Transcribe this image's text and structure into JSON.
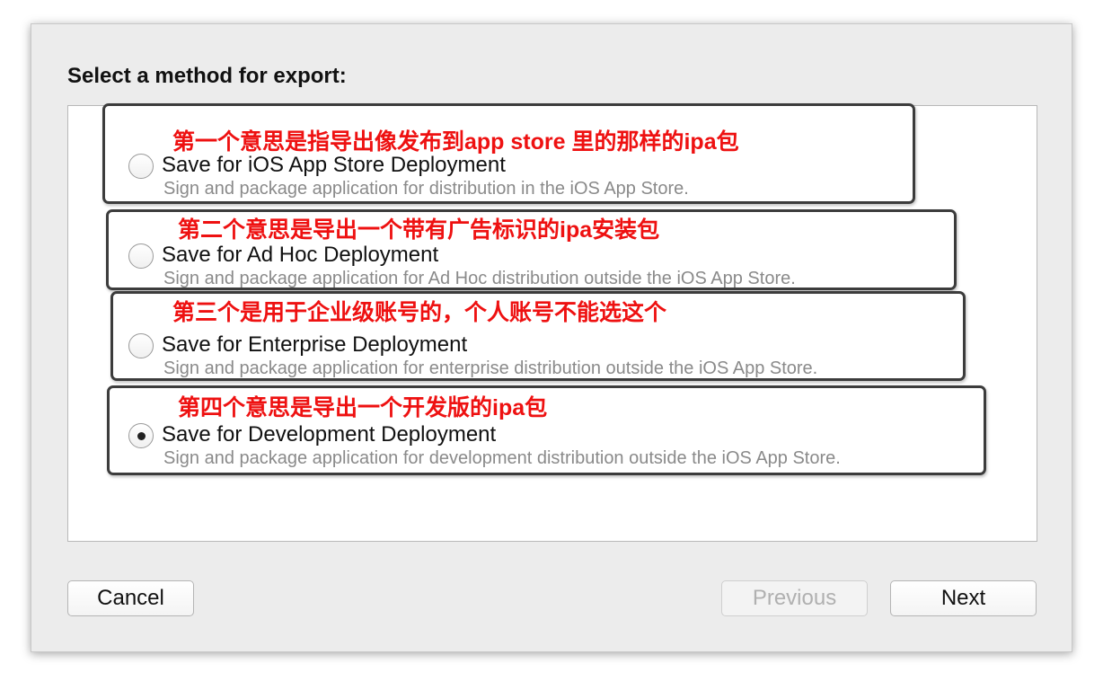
{
  "dialog": {
    "heading": "Select a method for export:"
  },
  "options": [
    {
      "title": "Save for iOS App Store Deployment",
      "description": "Sign and package application for distribution in the iOS App Store.",
      "selected": false,
      "annotation": "第一个意思是指导出像发布到app store 里的那样的ipa包"
    },
    {
      "title": "Save for Ad Hoc Deployment",
      "description": "Sign and package application for Ad Hoc distribution outside the iOS App Store.",
      "selected": false,
      "annotation": "第二个意思是导出一个带有广告标识的ipa安装包"
    },
    {
      "title": "Save for Enterprise Deployment",
      "description": "Sign and package application for enterprise distribution outside the iOS App Store.",
      "selected": false,
      "annotation": "第三个是用于企业级账号的，个人账号不能选这个"
    },
    {
      "title": "Save for Development Deployment",
      "description": "Sign and package application for development distribution outside the iOS App Store.",
      "selected": true,
      "annotation": "第四个意思是导出一个开发版的ipa包"
    }
  ],
  "buttons": {
    "cancel": "Cancel",
    "previous": "Previous",
    "next": "Next"
  },
  "colors": {
    "annotation_text": "#ee1111",
    "annotation_border": "#3c3c3c",
    "dialog_background": "#ececec"
  }
}
